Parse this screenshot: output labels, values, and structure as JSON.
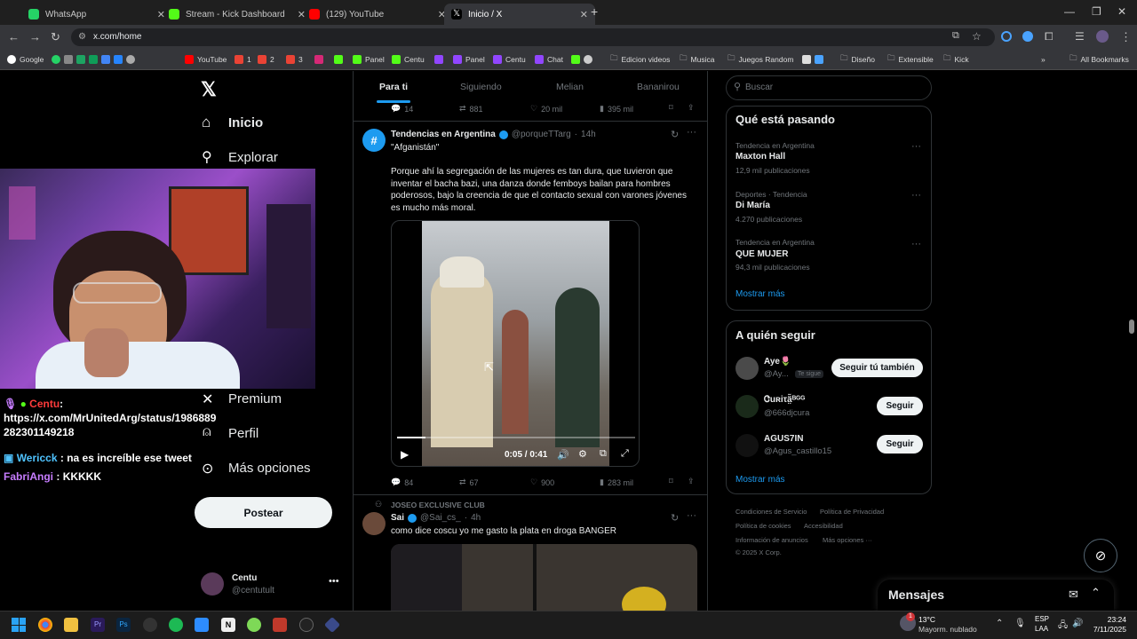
{
  "browser": {
    "tabs": [
      {
        "label": "WhatsApp",
        "color": "#25d366"
      },
      {
        "label": "Stream - Kick Dashboard",
        "color": "#53fc18"
      },
      {
        "label": "(129) YouTube",
        "color": "#ff0000"
      },
      {
        "label": "Inicio / X",
        "color": "#ffffff"
      }
    ],
    "url": "x.com/home",
    "bookmarks": [
      "Google",
      "YouTube",
      "1",
      "2",
      "3",
      "Panel",
      "Centu",
      "Panel",
      "Centu",
      "Chat",
      "Edicion videos",
      "Musica",
      "Juegos Random",
      "Diseño",
      "Extensible",
      "Kick"
    ],
    "all_bookmarks": "All Bookmarks"
  },
  "leftnav": {
    "home": "Inicio",
    "explore": "Explorar",
    "premium": "Premium",
    "profile": "Perfil",
    "more": "Más opciones",
    "post_button": "Postear",
    "user_name": "Centu",
    "user_handle": "@centutult"
  },
  "overlay_chat": [
    {
      "user": "Centu",
      "sep": ":",
      "text": "https://x.com/MrUnitedArg/status/1986889282301149218",
      "color": "#ff3b3b"
    },
    {
      "user": "Wericck",
      "sep": ":",
      "text": "na es increíble ese tweet",
      "color": "#4fc3ff"
    },
    {
      "user": "FabriAngi",
      "sep": ":",
      "text": "KKKKK",
      "color": "#c77dff"
    }
  ],
  "main": {
    "tabs": [
      "Para ti",
      "Siguiendo",
      "Melian",
      "Bananirou"
    ],
    "prev_tweet_stats": {
      "replies": "14",
      "reposts": "881",
      "likes": "20 mil",
      "views": "395 mil"
    },
    "tweet1": {
      "name": "Tendencias en Argentina",
      "handle": "@porqueTTarg",
      "time": "14h",
      "quote": "\"Afganistán\"",
      "body": "Porque ahí la segregación de las mujeres es tan dura, que tuvieron que inventar el bacha bazi, una danza donde femboys bailan para hombres poderosos, bajo la creencia de que el contacto sexual con varones jóvenes es mucho más moral.",
      "video_time": "0:05 / 0:41",
      "video_progress": 0.12,
      "stats": {
        "replies": "84",
        "reposts": "67",
        "likes": "900",
        "views": "283 mil"
      }
    },
    "tweet2": {
      "context": "JOSEO EXCLUSIVE CLUB",
      "name": "Sai",
      "handle": "@Sai_cs_",
      "time": "4h",
      "body": "como dice coscu yo me gasto la plata en droga BANGER"
    }
  },
  "right": {
    "search_placeholder": "Buscar",
    "trends_title": "Qué está pasando",
    "trends": [
      {
        "category": "Tendencia en Argentina",
        "title": "Maxton Hall",
        "count": "12,9 mil publicaciones"
      },
      {
        "category": "Deportes · Tendencia",
        "title": "Di María",
        "count": "4.270 publicaciones"
      },
      {
        "category": "Tendencia en Argentina",
        "title": "QUE MUJER",
        "count": "94,3 mil publicaciones"
      }
    ],
    "show_more": "Mostrar más",
    "follow_title": "A quién seguir",
    "follow": [
      {
        "name": "Aye🌷",
        "handle": "@Ay...",
        "badge": "Te sigue",
        "button": "Seguir tú también"
      },
      {
        "name": "Ꮳuʀiτä̤̃ᴮᴳᴳ",
        "handle": "@666djcura",
        "badge": "",
        "button": "Seguir"
      },
      {
        "name": "AGUS7IN",
        "handle": "@Agus_castillo15",
        "badge": "",
        "button": "Seguir"
      }
    ],
    "follow_more": "Mostrar más",
    "footer": [
      "Condiciones de Servicio",
      "Política de Privacidad",
      "Política de cookies",
      "Accesibilidad",
      "Información de anuncios",
      "Más opciones ···",
      "© 2025 X Corp."
    ],
    "messages": "Mensajes"
  },
  "taskbar": {
    "temp": "13°C",
    "weather": "Mayorm. nublado",
    "lang1": "ESP",
    "lang2": "LAA",
    "time": "23:24",
    "date": "7/11/2025",
    "notif": "1"
  }
}
